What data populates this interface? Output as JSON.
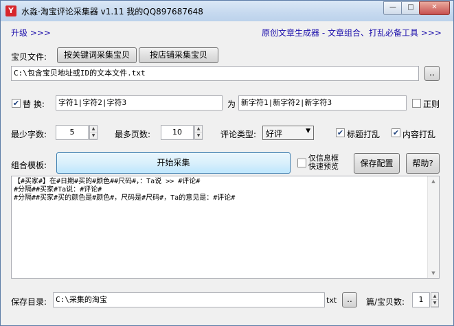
{
  "window": {
    "title": "水淼·淘宝评论采集器 v1.11   我的QQ897687648",
    "controls": {
      "min": "—",
      "max": "□",
      "close": "✕"
    }
  },
  "top": {
    "upgrade_link": "升级 >>>",
    "promo_link": "原创文章生成器 - 文章组合、打乱必备工具 >>>"
  },
  "source": {
    "label": "宝贝文件:",
    "by_keyword_button": "按关键词采集宝贝",
    "by_shop_button": "按店铺采集宝贝",
    "file_path": "C:\\包含宝贝地址或ID的文本文件.txt",
    "browse_button": ".."
  },
  "replace": {
    "checkbox_checked": true,
    "label": "替 换:",
    "from_value": "字符1|字符2|字符3",
    "to_label": "为",
    "to_value": "新字符1|新字符2|新字符3",
    "regex_label": "正则",
    "regex_checked": false
  },
  "options": {
    "min_chars_label": "最少字数:",
    "min_chars": "5",
    "max_pages_label": "最多页数:",
    "max_pages": "10",
    "comment_type_label": "评论类型:",
    "comment_type": "好评",
    "shuffle_title_label": "标题打乱",
    "shuffle_title_checked": true,
    "shuffle_content_label": "内容打乱",
    "shuffle_content_checked": true
  },
  "template": {
    "label": "组合模板:",
    "start_button": "开始采集",
    "quick_preview_label_line1": "仅信息框",
    "quick_preview_label_line2": "快速预览",
    "quick_preview_checked": false,
    "save_config_button": "保存配置",
    "help_button": "帮助?",
    "text": "【#买家#】在#日期#买的#颜色##尺码#，：Ta说 >> #评论#\n#分隔##买家#Ta说：#评论#\n#分隔##买家#买的颜色是#颜色#，尺码是#尺码#，Ta的意见是：#评论#"
  },
  "output": {
    "dir_label": "保存目录:",
    "dir_value": "C:\\采集的淘宝",
    "ext": "txt",
    "browse_button": "..",
    "per_file_label": "篇/宝贝数:",
    "per_file_value": "1"
  }
}
